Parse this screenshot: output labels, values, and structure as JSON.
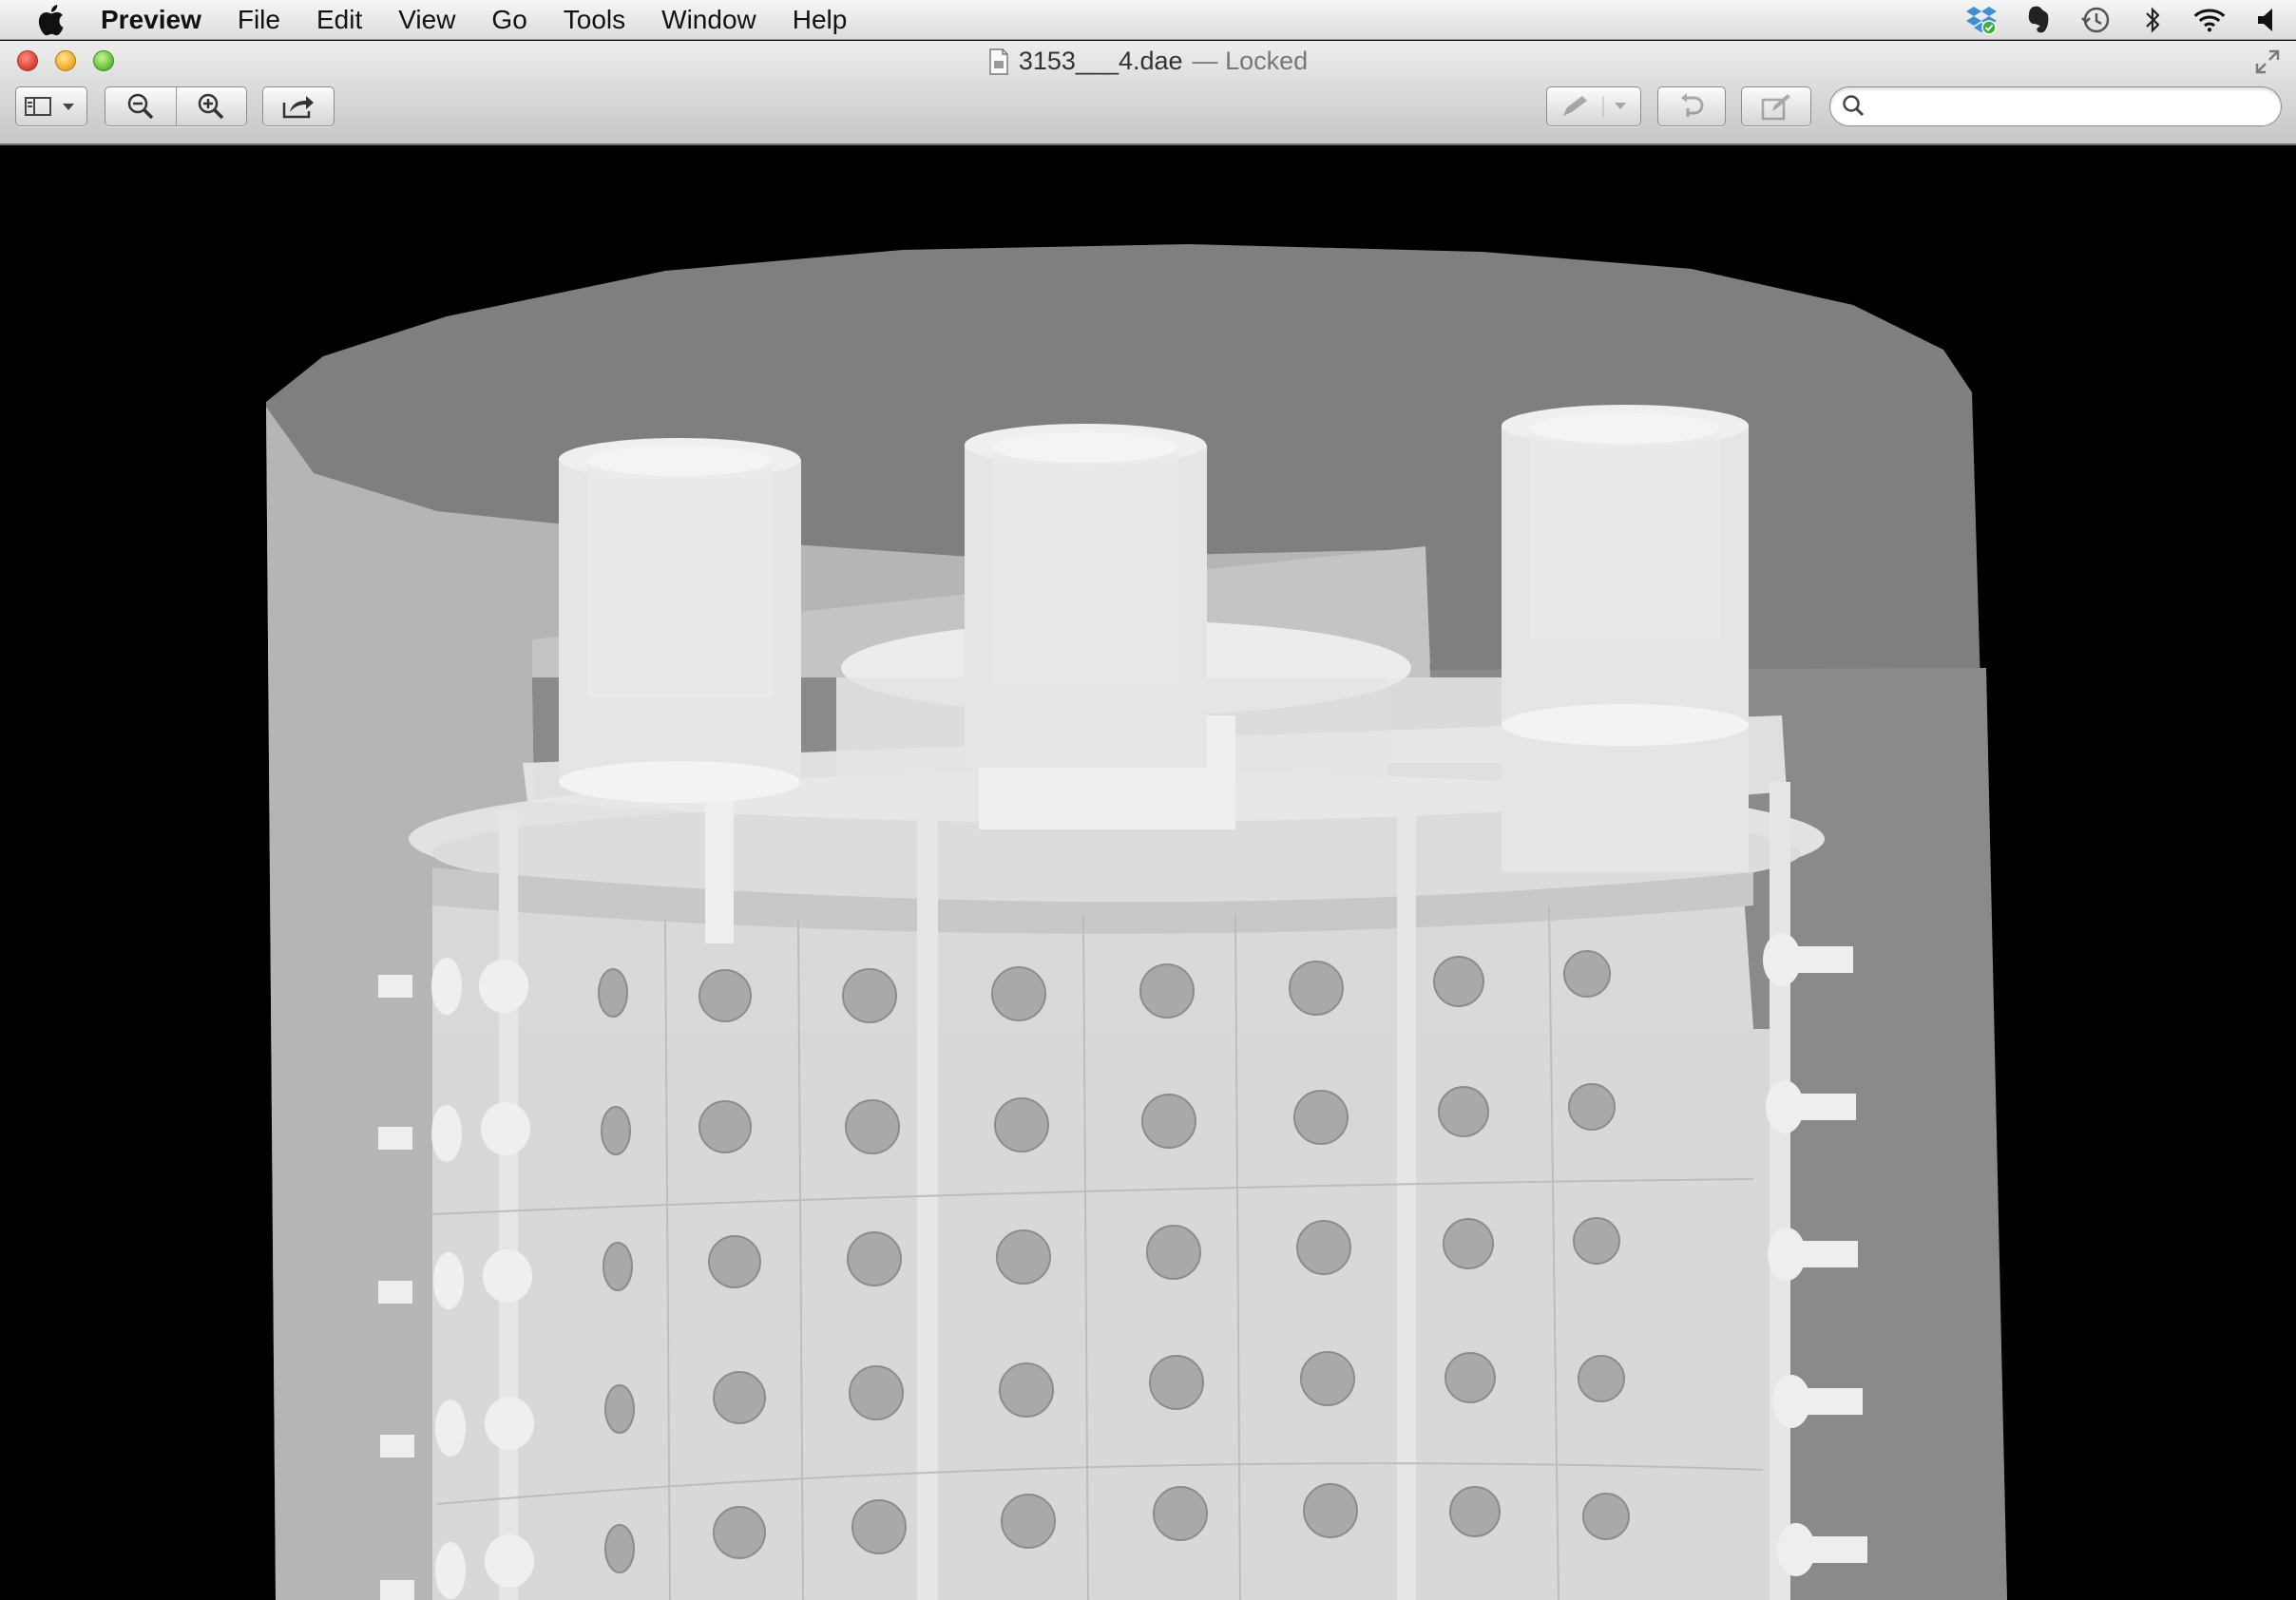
{
  "menubar": {
    "app_name": "Preview",
    "items": [
      "File",
      "Edit",
      "View",
      "Go",
      "Tools",
      "Window",
      "Help"
    ],
    "status_icons": [
      "dropbox-icon",
      "evernote-icon",
      "time-machine-icon",
      "bluetooth-icon",
      "wifi-icon",
      "volume-icon"
    ]
  },
  "window": {
    "filename": "3153___4.dae",
    "separator": "—",
    "status": "Locked"
  },
  "toolbar": {
    "buttons": [
      "sidebar-toggle-icon",
      "zoom-out-icon",
      "zoom-in-icon",
      "share-icon",
      "annotate-icon",
      "rotate-icon",
      "edit-icon"
    ],
    "search": {
      "value": "",
      "placeholder": ""
    }
  },
  "viewer": {
    "content": "3d-model",
    "background": "#000000",
    "model_colors": {
      "outer_cylinder": "#808080",
      "outer_front": "#b4b4b4",
      "body": "#d6d6d6",
      "holes": "#a8a8a8"
    }
  }
}
